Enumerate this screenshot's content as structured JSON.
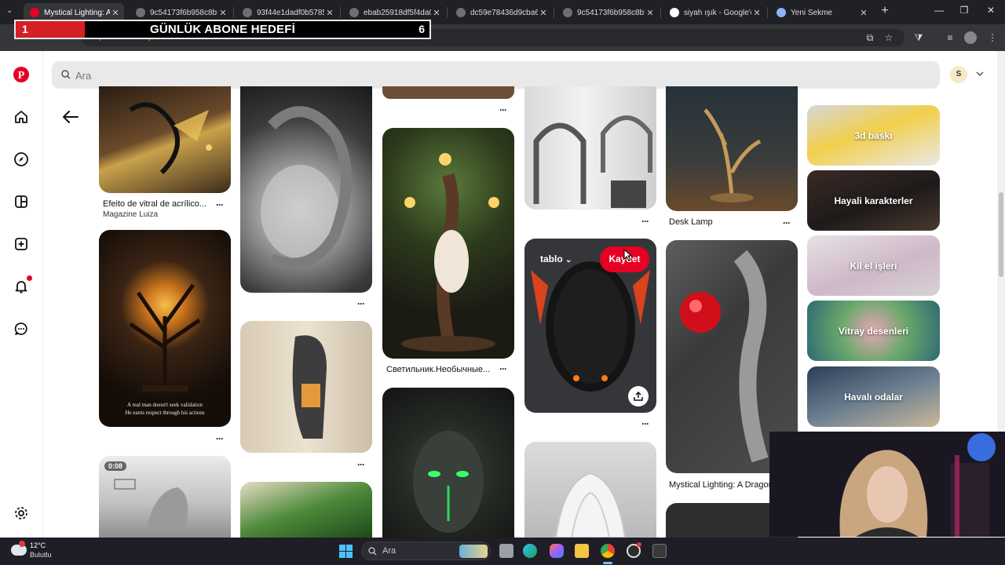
{
  "browser": {
    "tabs": [
      {
        "label": "Mystical Lighting: A",
        "active": true
      },
      {
        "label": "9c54173f6b958c8b5",
        "active": false
      },
      {
        "label": "93f44e1dadf0b5785",
        "active": false
      },
      {
        "label": "ebab25918df5f4da0",
        "active": false
      },
      {
        "label": "dc59e78436d9cba67",
        "active": false
      },
      {
        "label": "9c54173f6b958c8b5",
        "active": false
      },
      {
        "label": "siyah ışık - Google'da",
        "active": false
      },
      {
        "label": "Yeni Sekme",
        "active": false
      }
    ],
    "url": "tr.pinterest.com/pin/142849238130001997/"
  },
  "overlay": {
    "goal_title": "GÜNLÜK ABONE HEDEFİ",
    "current": "1",
    "target": "6",
    "progress_fraction": 0.167
  },
  "header": {
    "search_placeholder": "Ara",
    "avatar_initial": "S"
  },
  "pins": {
    "col1_title": "Efeito de vitral de acrílico...",
    "col1_subtitle": "Magazine Luiza",
    "col1_quote_line1": "A real man doesn't seek validation",
    "col1_quote_line2": "He earns respect through his actions",
    "col1_video_duration": "0:08",
    "col3_title": "Светильник.Необычные...",
    "col4_board": "tablo",
    "col4_save": "Kaydet",
    "col5_title1": "Desk Lamp",
    "col5_title2": "Mystical Lighting: A Dragon"
  },
  "categories": [
    {
      "label": "3d baskı"
    },
    {
      "label": "Hayali karakterler"
    },
    {
      "label": "Kil el işleri"
    },
    {
      "label": "Vitray desenleri"
    },
    {
      "label": "Havalı odalar"
    }
  ],
  "taskbar": {
    "weather_temp": "12°C",
    "weather_desc": "Bulutlu",
    "search_placeholder": "Ara"
  },
  "colors": {
    "pinterest_red": "#e60023",
    "chrome_dark": "#202124"
  }
}
